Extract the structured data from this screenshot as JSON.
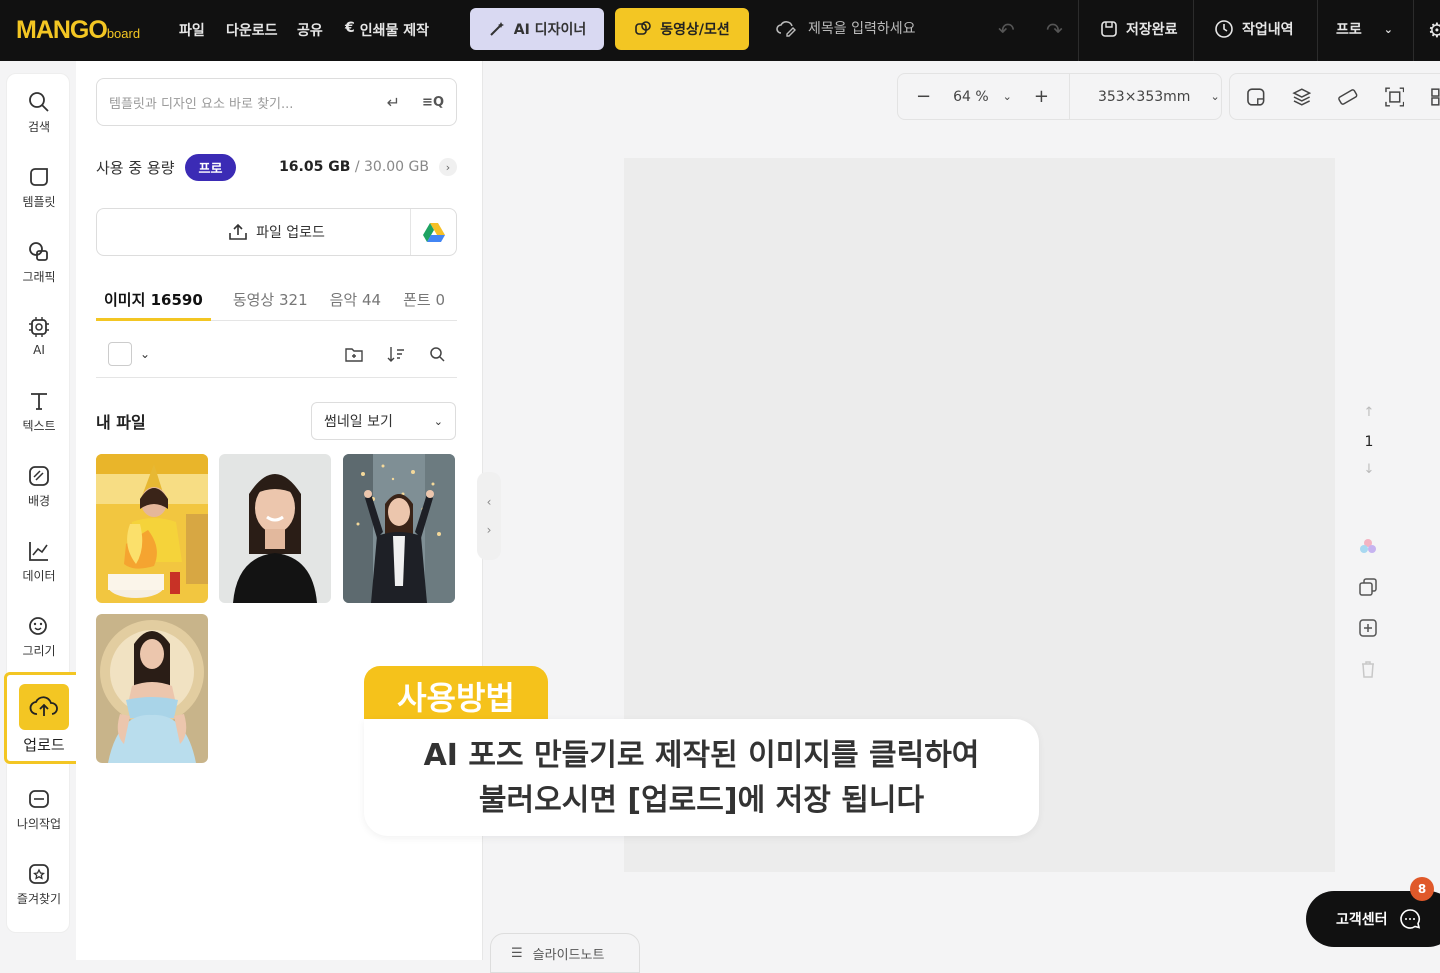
{
  "topbar": {
    "logo": "MANGO",
    "logo_small": "board",
    "menu": [
      "파일",
      "다운로드",
      "공유",
      "인쇄물 제작"
    ],
    "ai_designer": "AI 디자이너",
    "video_motion": "동영상/모션",
    "title_placeholder": "제목을 입력하세요",
    "save_status": "저장완료",
    "history": "작업내역",
    "plan": "프로"
  },
  "sidebar": {
    "items": [
      {
        "label": "검색",
        "icon": "search-icon"
      },
      {
        "label": "템플릿",
        "icon": "template-icon"
      },
      {
        "label": "그래픽",
        "icon": "graphic-icon"
      },
      {
        "label": "AI",
        "icon": "ai-chip-icon"
      },
      {
        "label": "텍스트",
        "icon": "text-icon"
      },
      {
        "label": "배경",
        "icon": "background-icon"
      },
      {
        "label": "데이터",
        "icon": "chart-icon"
      },
      {
        "label": "그리기",
        "icon": "draw-icon"
      },
      {
        "label": "업로드",
        "icon": "upload-cloud-icon"
      },
      {
        "label": "나의작업",
        "icon": "my-work-icon"
      },
      {
        "label": "즐겨찾기",
        "icon": "favorite-icon"
      }
    ]
  },
  "panel": {
    "search_placeholder": "템플릿과 디자인 요소 바로 찾기...",
    "usage_label": "사용 중 용량",
    "plan_badge": "프로",
    "usage_used": "16.05 GB",
    "usage_total": "/ 30.00 GB",
    "upload_button": "파일 업로드",
    "tabs": [
      {
        "label": "이미지 16590",
        "active": true
      },
      {
        "label": "동영상 321",
        "active": false
      },
      {
        "label": "음악 44",
        "active": false
      },
      {
        "label": "폰트 0",
        "active": false
      }
    ],
    "my_files": "내 파일",
    "view_select": "썸네일 보기"
  },
  "canvas": {
    "zoom": "64 %",
    "size": "353×353mm",
    "page_number": "1"
  },
  "callout": {
    "tag": "사용방법",
    "line1": "AI 포즈 만들기로 제작된 이미지를 클릭하여",
    "line2": "불러오시면 [업로드]에 저장 됩니다"
  },
  "footer": {
    "slide_notes": "슬라이드노트",
    "support": "고객센터",
    "support_badge": "8"
  },
  "colors": {
    "accent_yellow": "#f3c623",
    "badge_purple": "#3b2bb5",
    "topbar": "#111111"
  }
}
